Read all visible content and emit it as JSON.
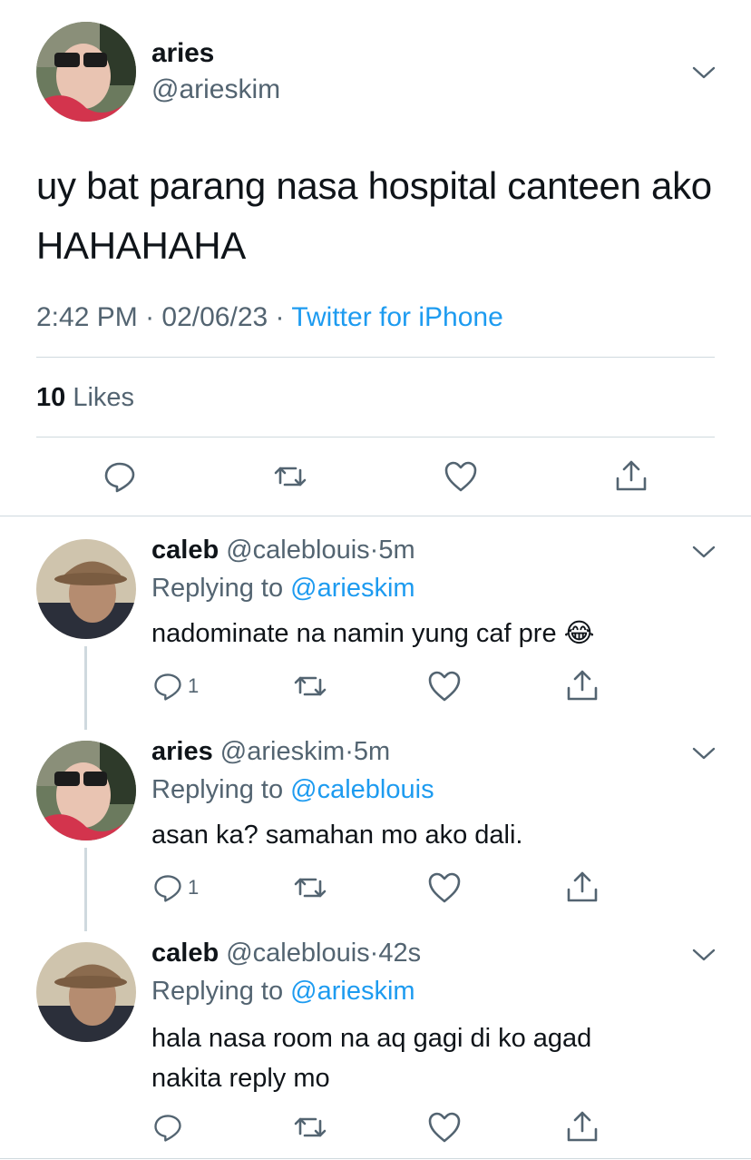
{
  "main_tweet": {
    "author_name": "aries",
    "handle": "@arieskim",
    "text": "uy bat parang nasa hospital canteen ako HAHAHAHA",
    "time": "2:42 PM",
    "date": "02/06/23",
    "source": "Twitter for iPhone",
    "likes_count": "10",
    "likes_label": "Likes",
    "avatar": "avatar-aries"
  },
  "replies": [
    {
      "author_name": "caleb",
      "handle": "@caleblouis",
      "time": "5m",
      "replying_label": "Replying to",
      "replying_to": "@arieskim",
      "text": "nadominate na namin yung caf pre 😂",
      "reply_count": "1",
      "avatar": "avatar-caleb"
    },
    {
      "author_name": "aries",
      "handle": "@arieskim",
      "time": "5m",
      "replying_label": "Replying to",
      "replying_to": "@caleblouis",
      "text": "asan ka? samahan mo ako dali.",
      "reply_count": "1",
      "avatar": "avatar-aries"
    },
    {
      "author_name": "caleb",
      "handle": "@caleblouis",
      "time": "42s",
      "replying_label": "Replying to",
      "replying_to": "@arieskim",
      "text": "hala nasa room na aq gagi di ko agad nakita reply mo",
      "reply_count": "",
      "avatar": "avatar-caleb"
    }
  ],
  "separators": {
    "dot": "·"
  },
  "colors": {
    "text": "#0f1419",
    "secondary": "#536471",
    "accent": "#1d9bf0",
    "divider": "#cfd9de"
  },
  "icons": [
    "chevron-down-icon",
    "reply-icon",
    "retweet-icon",
    "like-icon",
    "share-icon"
  ]
}
